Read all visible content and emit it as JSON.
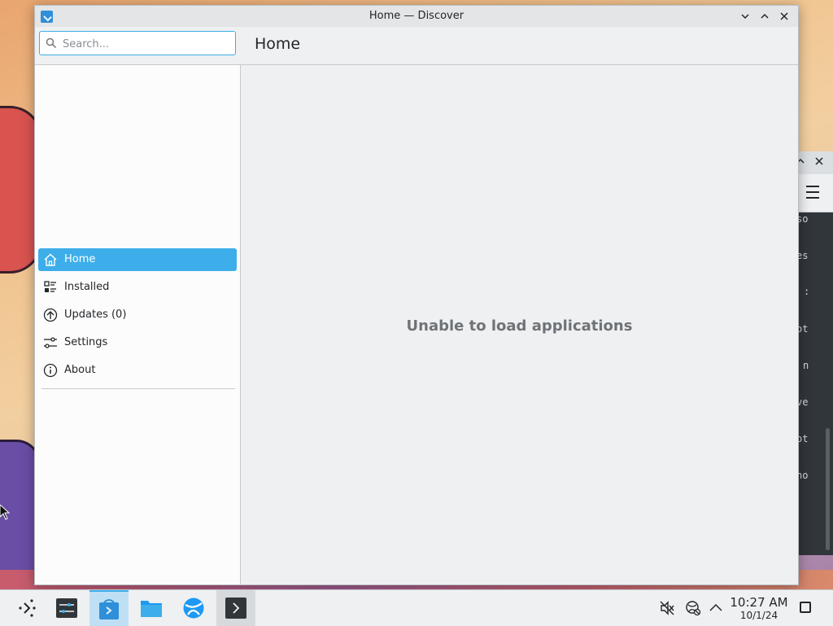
{
  "window": {
    "title": "Home — Discover",
    "minimize_icon": "chevron-down-icon",
    "maximize_icon": "chevron-up-icon",
    "close_icon": "close-icon"
  },
  "search": {
    "placeholder": "Search...",
    "value": ""
  },
  "header": {
    "page_title": "Home"
  },
  "sidebar": {
    "items": [
      {
        "label": "Home",
        "icon": "home-icon",
        "active": true
      },
      {
        "label": "Installed",
        "icon": "installed-icon",
        "active": false
      },
      {
        "label": "Updates (0)",
        "icon": "updates-icon",
        "active": false
      },
      {
        "label": "Settings",
        "icon": "settings-icon",
        "active": false
      },
      {
        "label": "About",
        "icon": "info-icon",
        "active": false
      }
    ]
  },
  "main": {
    "message": "Unable to load applications"
  },
  "background_terminal": {
    "lines": [
      "so",
      "es",
      ":",
      "ot",
      "n",
      "ve",
      "ot",
      "no"
    ]
  },
  "taskbar": {
    "apps": [
      {
        "name": "application-launcher",
        "icon": "app-launcher-icon"
      },
      {
        "name": "system-settings",
        "icon": "system-settings-icon"
      },
      {
        "name": "discover",
        "icon": "discover-icon",
        "active": true
      },
      {
        "name": "file-manager",
        "icon": "folder-icon"
      },
      {
        "name": "web-browser",
        "icon": "browser-icon"
      },
      {
        "name": "terminal",
        "icon": "terminal-icon",
        "running": true
      }
    ],
    "tray": {
      "volume_icon": "volume-muted-icon",
      "network_icon": "network-icon",
      "expand_icon": "chevron-up-icon"
    },
    "clock": {
      "time": "10:27 AM",
      "date": "10/1/24"
    }
  },
  "colors": {
    "accent": "#3daee9",
    "window_bg": "#fcfcfc",
    "content_bg": "#eff0f1",
    "text": "#232629",
    "muted_text": "#6e7378"
  }
}
